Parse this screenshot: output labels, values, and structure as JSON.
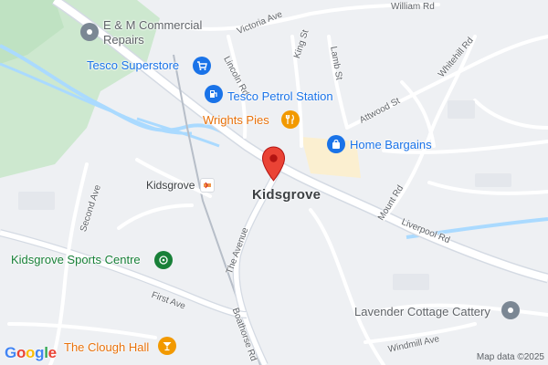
{
  "map": {
    "town_label": "Kidsgrove",
    "station_label": "Kidsgrove",
    "streets": {
      "william_rd": "William Rd",
      "victoria_ave": "Victoria Ave",
      "lincoln_rd": "Lincoln Rd",
      "king_st": "King St",
      "lamb_st": "Lamb St",
      "whitehill_rd": "Whitehill Rd",
      "attwood_st": "Attwood St",
      "mount_rd": "Mount Rd",
      "liverpool_rd": "Liverpool Rd",
      "second_ave": "Second Ave",
      "the_avenue": "The Avenue",
      "first_ave": "First Ave",
      "boathorse_rd": "Boathorse Rd",
      "windmill_ave": "Windmill Ave"
    },
    "pois": {
      "em_repairs_line1": "E & M Commercial",
      "em_repairs_line2": "Repairs",
      "tesco_superstore": "Tesco Superstore",
      "tesco_petrol": "Tesco Petrol Station",
      "wrights_pies": "Wrights Pies",
      "home_bargains": "Home Bargains",
      "sports_centre": "Kidsgrove Sports Centre",
      "lavender_cattery": "Lavender Cottage Cattery",
      "clough_hall": "The Clough Hall"
    },
    "icons": {
      "repair": "repair-pin-icon",
      "shopping_cart": "shopping-cart-icon",
      "fuel": "fuel-icon",
      "restaurant": "restaurant-icon",
      "shopping_bag": "shopping-bag-icon",
      "sports": "sports-icon",
      "pet": "pet-service-icon",
      "bar": "cocktail-icon",
      "rail": "train-station-icon",
      "marker": "location-marker-icon"
    },
    "colors": {
      "background": "#eef0f3",
      "road": "#ffffff",
      "major_road": "#d4dae3",
      "water": "#aadaff",
      "park": "#c8e6c9",
      "blue_poi": "#1a73e8",
      "orange_poi": "#e8710a",
      "green_poi": "#188038",
      "marker": "#ea4335"
    },
    "attribution": "Map data ©2025",
    "logo": {
      "g1": "G",
      "o1": "o",
      "o2": "o",
      "g2": "g",
      "l": "l",
      "e": "e"
    }
  }
}
